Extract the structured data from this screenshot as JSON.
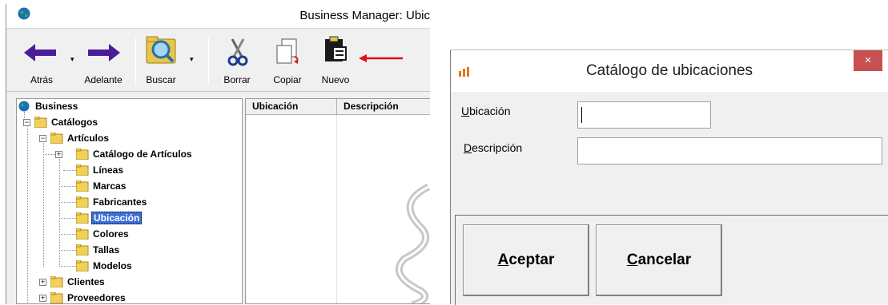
{
  "left_window": {
    "title": "Business Manager: Ubic",
    "toolbar": {
      "back": "Atrás",
      "forward": "Adelante",
      "search": "Buscar",
      "delete": "Borrar",
      "copy": "Copiar",
      "new": "Nuevo"
    },
    "tree": [
      "Business",
      "Catálogos",
      "Artículos",
      "Catálogo de Artículos",
      "Líneas",
      "Marcas",
      "Fabricantes",
      "Ubicación",
      "Colores",
      "Tallas",
      "Modelos",
      "Clientes",
      "Proveedores"
    ],
    "grid": {
      "columns": [
        "Ubicación",
        "Descripción"
      ]
    }
  },
  "dialog": {
    "title": "Catálogo de ubicaciones",
    "close": "×",
    "fields": {
      "ubicacion": {
        "label_mnemonic": "U",
        "label_rest": "bicación",
        "value": ""
      },
      "descripcion": {
        "label_mnemonic": "D",
        "label_rest": "escripción",
        "value": ""
      }
    },
    "buttons": {
      "accept": {
        "mnemonic": "A",
        "rest": "ceptar"
      },
      "cancel": {
        "mnemonic": "C",
        "rest": "ancelar"
      }
    }
  }
}
